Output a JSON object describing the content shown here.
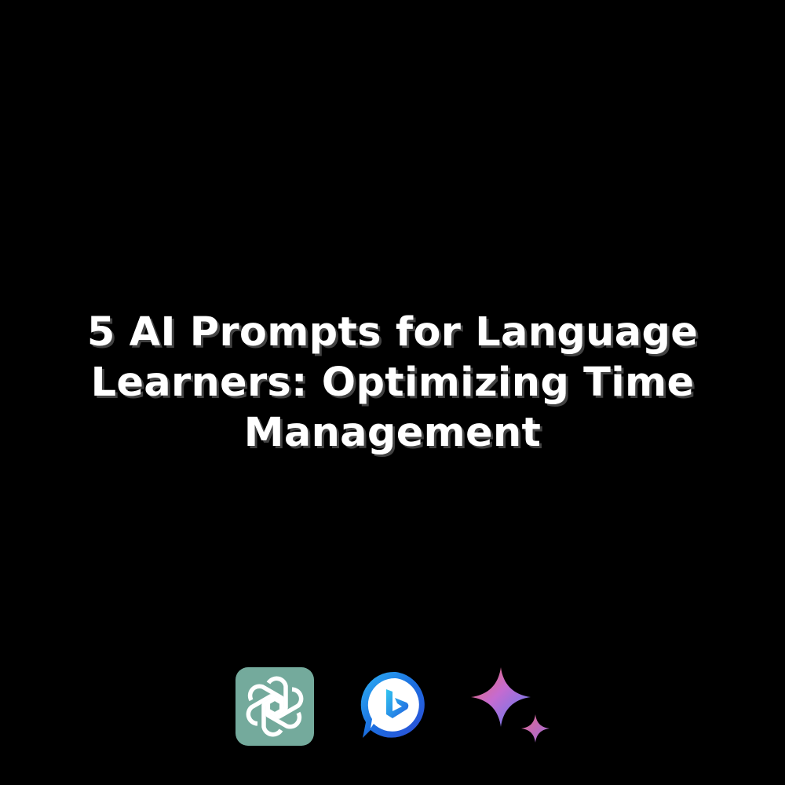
{
  "title": {
    "lines": [
      "5 AI Prompts for Language",
      "Learners: Optimizing Time",
      "Management"
    ]
  },
  "logos": [
    {
      "icon": "chatgpt-logo-icon",
      "color": "#74AA9C"
    },
    {
      "icon": "bing-chat-logo-icon",
      "color": "#1B6FE0"
    },
    {
      "icon": "gemini-sparkle-icon",
      "color": "#E9677E"
    }
  ],
  "colors": {
    "background": "#000000",
    "title_text": "#FFFFFF"
  }
}
